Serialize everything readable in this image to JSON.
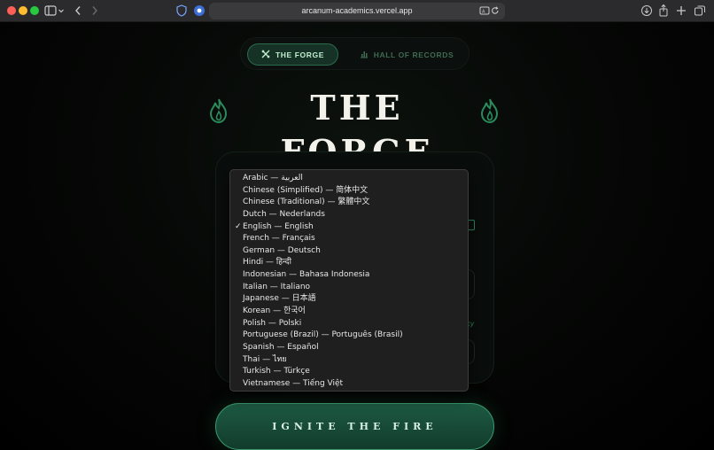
{
  "browser": {
    "url": "arcanum-academics.vercel.app"
  },
  "nav": {
    "tabs": [
      {
        "label": "THE FORGE",
        "icon": "forge-icon",
        "active": true
      },
      {
        "label": "HALL OF RECORDS",
        "icon": "bar-chart-icon",
        "active": false
      }
    ]
  },
  "header": {
    "title": "THE FORGE"
  },
  "language_dropdown": {
    "options": [
      "Arabic — العربية",
      "Chinese (Simplified) — 简体中文",
      "Chinese (Traditional) — 繁體中文",
      "Dutch — Nederlands",
      "English — English",
      "French — Français",
      "German — Deutsch",
      "Hindi — हिन्दी",
      "Indonesian — Bahasa Indonesia",
      "Italian — Italiano",
      "Japanese — 日本語",
      "Korean — 한국어",
      "Polish — Polski",
      "Portuguese (Brazil) — Português (Brasil)",
      "Spanish — Español",
      "Thai — ไทย",
      "Turkish — Türkçe",
      "Vietnamese — Tiếng Việt"
    ],
    "selected": "English — English",
    "check_mark": "✓"
  },
  "card": {
    "partial_text": "cy"
  },
  "cta": {
    "label": "IGNITE THE FIRE"
  },
  "colors": {
    "accent": "#2c8a5c",
    "active_tab_bg": "#163126",
    "cta_bg": "#1d5a42"
  }
}
